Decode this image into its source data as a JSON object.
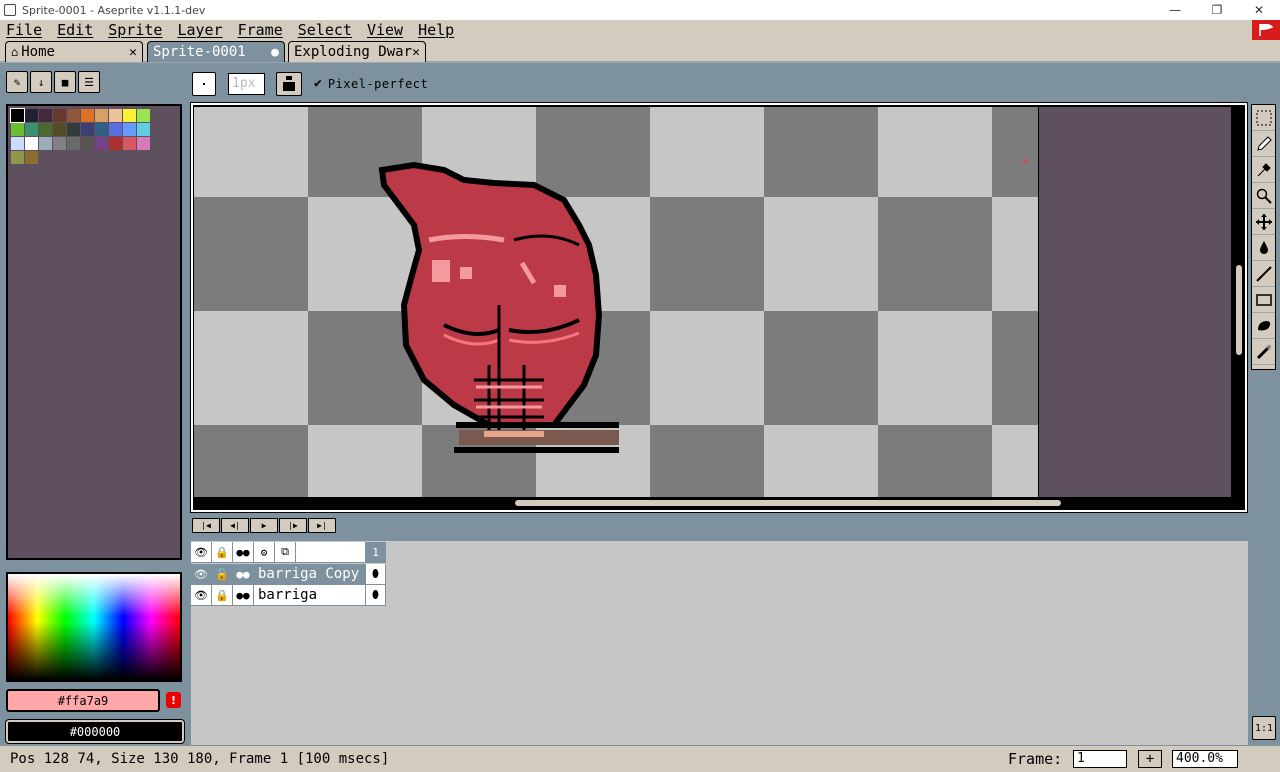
{
  "window": {
    "title": "Sprite-0001 - Aseprite v1.1.1-dev",
    "controls": [
      "—",
      "❐",
      "✕"
    ]
  },
  "menu": [
    "File",
    "Edit",
    "Sprite",
    "Layer",
    "Frame",
    "Select",
    "View",
    "Help"
  ],
  "tabs": [
    {
      "label": "Home",
      "close": "✕"
    },
    {
      "label": "Sprite-0001",
      "close": "●"
    },
    {
      "label": "Exploding Dwar",
      "close": "✕"
    }
  ],
  "context_bar": {
    "brush_size": "1px",
    "pixel_perfect_label": "Pixel-perfect",
    "pixel_perfect_checked": true
  },
  "palette": [
    "#000000",
    "#222034",
    "#45283c",
    "#663931",
    "#8f563b",
    "#df7126",
    "#d9a066",
    "#eec39a",
    "#fbf236",
    "#99e550",
    "#6abe30",
    "#37946e",
    "#4b692f",
    "#524b24",
    "#323c39",
    "#3f3f74",
    "#306082",
    "#5b6ee1",
    "#639bff",
    "#5fcde4",
    "#cbdbfc",
    "#ffffff",
    "#9badb7",
    "#847e87",
    "#696a6a",
    "#595652",
    "#76428a",
    "#ac3232",
    "#d95763",
    "#d77bba",
    "#8f974a",
    "#8a6f30"
  ],
  "colors": {
    "foreground": "#ffa7a9",
    "foreground_label": "#ffa7a9",
    "background": "#000000",
    "background_label": "#000000",
    "warning": "!"
  },
  "timeline": {
    "header_frame": "1",
    "layers": [
      {
        "name": "barriga Copy (",
        "selected": true
      },
      {
        "name": "barriga",
        "selected": false
      }
    ],
    "zoom_fit_label": "1:1"
  },
  "status": {
    "text": "Pos 128 74, Size 130 180, Frame 1 [100 msecs]",
    "frame_label": "Frame:",
    "frame_value": "1",
    "plus": "+",
    "zoom_value": "400.0%"
  }
}
